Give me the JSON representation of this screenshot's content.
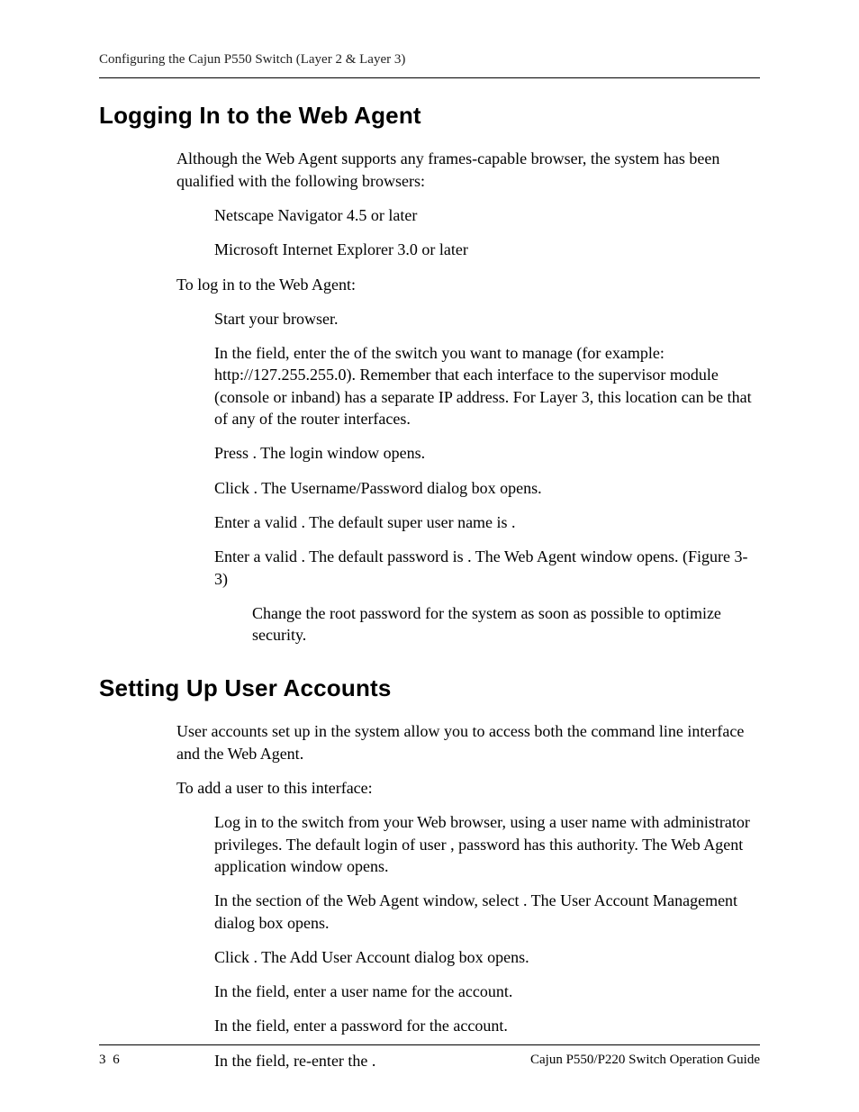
{
  "running_head": "Configuring the Cajun P550 Switch (Layer 2 & Layer 3)",
  "section1": {
    "title": "Logging In to the Web Agent",
    "intro": "Although the Web Agent supports any frames-capable browser, the system has been qualified with the following browsers:",
    "browsers": [
      "Netscape Navigator 4.5 or later",
      "Microsoft Internet Explorer 3.0 or later"
    ],
    "login_lead": "To log in to the Web Agent:",
    "steps": [
      "Start your browser.",
      "In the               field, enter the         of the switch you want to manage (for example: http://127.255.255.0). Remember that each interface to the supervisor module (console or inband) has a separate IP address. For Layer 3, this location can be that of any of the router interfaces.",
      "Press           . The login window opens.",
      "Click            . The Username/Password dialog box opens.",
      "Enter a valid                     . The default super user name is         .",
      "Enter a valid                     . The default password is          . The Web Agent window opens. (Figure 3-3)"
    ],
    "note": "Change the root password for the system as soon as possible to optimize security."
  },
  "section2": {
    "title": "Setting Up User Accounts",
    "intro": "User accounts set up in the system allow you to access both the command line interface and the Web Agent.",
    "add_lead": "To add a user to this interface:",
    "steps": [
      "Log in to the switch from your Web browser, using a user name with administrator privileges. The default login of user         , password           has this authority. The Web Agent application window opens.",
      "In the                                             section of the Web Agent window, select                          . The User Account Management dialog box opens.",
      "Click                 . The Add User Account dialog box opens.",
      "In the                     field, enter a user name for the account.",
      "In the                   field, enter a password for the account.",
      "In the                                   field, re-enter the                              ."
    ]
  },
  "footer": {
    "page": "3 6",
    "guide": "Cajun P550/P220 Switch Operation Guide"
  }
}
